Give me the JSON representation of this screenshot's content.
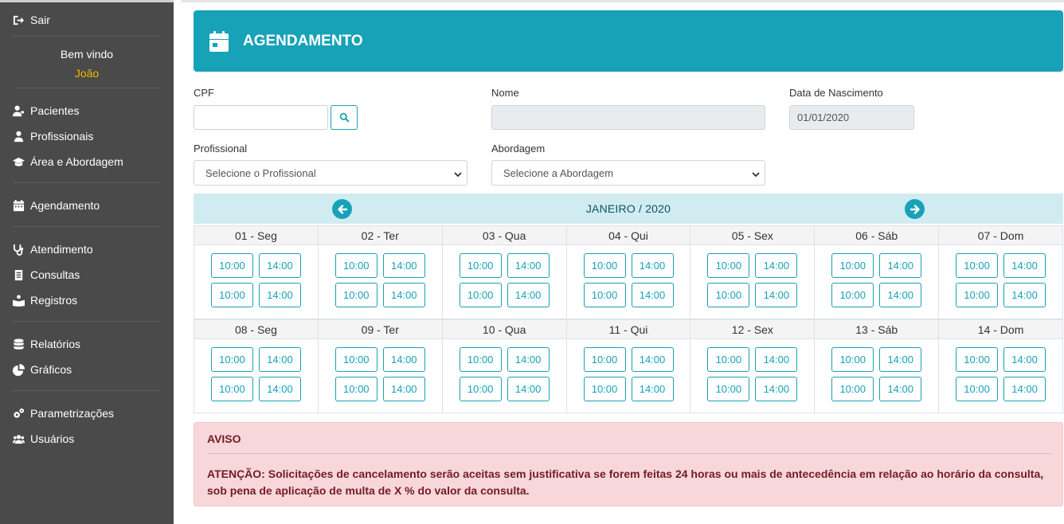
{
  "sidebar": {
    "logout_label": "Sair",
    "welcome_text": "Bem vindo",
    "user_name": "João",
    "groups": [
      [
        {
          "label": "Pacientes",
          "icon": "user-injured-icon"
        },
        {
          "label": "Profissionais",
          "icon": "user-md-icon"
        },
        {
          "label": "Área e Abordagem",
          "icon": "graduation-cap-icon"
        }
      ],
      [
        {
          "label": "Agendamento",
          "icon": "calendar-icon"
        }
      ],
      [
        {
          "label": "Atendimento",
          "icon": "stethoscope-icon"
        },
        {
          "label": "Consultas",
          "icon": "file-list-icon"
        },
        {
          "label": "Registros",
          "icon": "book-reader-icon"
        }
      ],
      [
        {
          "label": "Relatórios",
          "icon": "database-icon"
        },
        {
          "label": "Gráficos",
          "icon": "pie-chart-icon"
        }
      ],
      [
        {
          "label": "Parametrizações",
          "icon": "cogs-icon"
        },
        {
          "label": "Usuários",
          "icon": "users-icon"
        }
      ]
    ]
  },
  "header": {
    "title": "AGENDAMENTO",
    "icon": "calendar-icon",
    "color": "#17a2b8"
  },
  "form": {
    "cpf_label": "CPF",
    "cpf_value": "",
    "nome_label": "Nome",
    "nome_value": "",
    "nascimento_label": "Data de Nascimento",
    "nascimento_value": "01/01/2020",
    "profissional_label": "Profissional",
    "profissional_selected": "Selecione o Profissional",
    "abordagem_label": "Abordagem",
    "abordagem_selected": "Selecione a Abordagem"
  },
  "calendar": {
    "month_label": "JANEIRO / 2020",
    "weeks": [
      [
        {
          "day": "01 - Seg",
          "slots": [
            "10:00",
            "14:00",
            "10:00",
            "14:00"
          ]
        },
        {
          "day": "02 - Ter",
          "slots": [
            "10:00",
            "14:00",
            "10:00",
            "14:00"
          ]
        },
        {
          "day": "03 - Qua",
          "slots": [
            "10:00",
            "14:00",
            "10:00",
            "14:00"
          ]
        },
        {
          "day": "04 - Qui",
          "slots": [
            "10:00",
            "14:00",
            "10:00",
            "14:00"
          ]
        },
        {
          "day": "05 - Sex",
          "slots": [
            "10:00",
            "14:00",
            "10:00",
            "14:00"
          ]
        },
        {
          "day": "06 - Sáb",
          "slots": [
            "10:00",
            "14:00",
            "10:00",
            "14:00"
          ]
        },
        {
          "day": "07 - Dom",
          "slots": [
            "10:00",
            "14:00",
            "10:00",
            "14:00"
          ]
        }
      ],
      [
        {
          "day": "08 - Seg",
          "slots": [
            "10:00",
            "14:00",
            "10:00",
            "14:00"
          ]
        },
        {
          "day": "09 - Ter",
          "slots": [
            "10:00",
            "14:00",
            "10:00",
            "14:00"
          ]
        },
        {
          "day": "10 - Qua",
          "slots": [
            "10:00",
            "14:00",
            "10:00",
            "14:00"
          ]
        },
        {
          "day": "11 - Qui",
          "slots": [
            "10:00",
            "14:00",
            "10:00",
            "14:00"
          ]
        },
        {
          "day": "12 - Sex",
          "slots": [
            "10:00",
            "14:00",
            "10:00",
            "14:00"
          ]
        },
        {
          "day": "13 - Sáb",
          "slots": [
            "10:00",
            "14:00",
            "10:00",
            "14:00"
          ]
        },
        {
          "day": "14 - Dom",
          "slots": [
            "10:00",
            "14:00",
            "10:00",
            "14:00"
          ]
        }
      ]
    ]
  },
  "alert": {
    "title": "AVISO",
    "text": "ATENÇÃO: Solicitações de cancelamento serão aceitas sem justificativa se forem feitas 24 horas ou mais de antecedência em relação ao horário da consulta, sob pena de aplicação de multa de X % do valor da consulta."
  }
}
